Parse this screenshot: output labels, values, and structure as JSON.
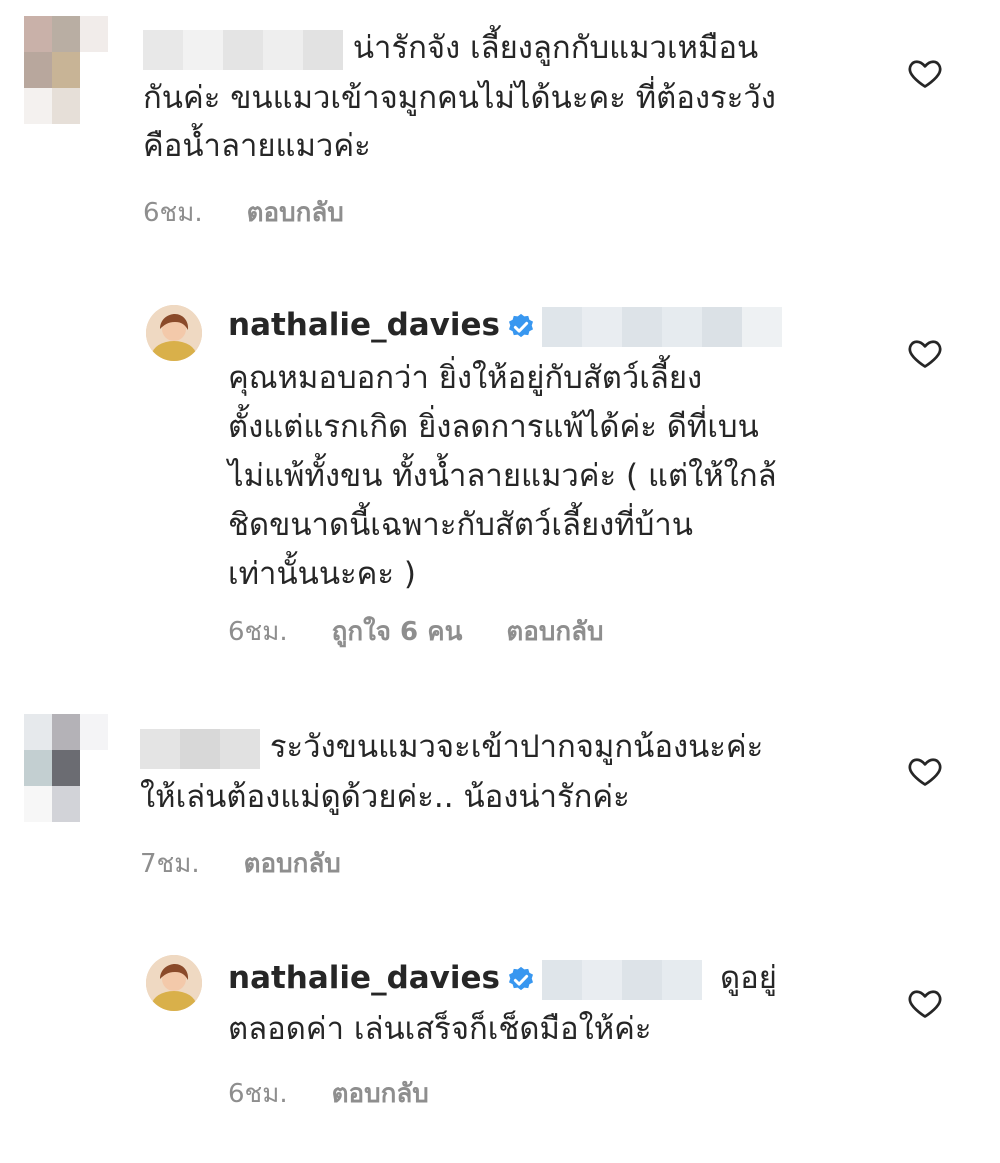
{
  "comments": [
    {
      "text_line1": "น่ารักจัง เลี้ยงลูกกับแมวเหมือน",
      "text_line2": "กันค่ะ ขนแมวเข้าจมูกคนไม่ได้นะคะ ที่ต้องระวัง",
      "text_line3": "คือน้ำลายแมวค่ะ",
      "time": "6ชม.",
      "reply_label": "ตอบกลับ"
    },
    {
      "username": "nathalie_davies",
      "text_line1": "คุณหมอบอกว่า ยิ่งให้อยู่กับสัตว์เลี้ยง",
      "text_line2": "ตั้งแต่แรกเกิด ยิ่งลดการแพ้ได้ค่ะ ดีที่เบน",
      "text_line3": "ไม่แพ้ทั้งขน ทั้งน้ำลายแมวค่ะ ( แต่ให้ใกล้",
      "text_line4": "ชิดขนาดนี้เฉพาะกับสัตว์เลี้ยงที่บ้าน",
      "text_line5": "เท่านั้นนะคะ )",
      "time": "6ชม.",
      "likes": "ถูกใจ 6 คน",
      "reply_label": "ตอบกลับ"
    },
    {
      "text_line1": "ระวังขนแมวจะเข้าปากจมูกน้องนะค่ะ",
      "text_line2": "ให้เล่นต้องแม่ดูด้วยค่ะ.. น้องน่ารักค่ะ",
      "time": "7ชม.",
      "reply_label": "ตอบกลับ"
    },
    {
      "username": "nathalie_davies",
      "text_tail": "ดูอยู่",
      "text_line2": "ตลอดค่า  เล่นเสร็จก็เช็ดมือให้ค่ะ",
      "time": "6ชม.",
      "reply_label": "ตอบกลับ"
    }
  ],
  "colors": {
    "verified": "#3897f0",
    "muted": "#8e8e8e",
    "text": "#262626"
  },
  "icons": [
    "heart-icon",
    "verified-badge-icon"
  ]
}
